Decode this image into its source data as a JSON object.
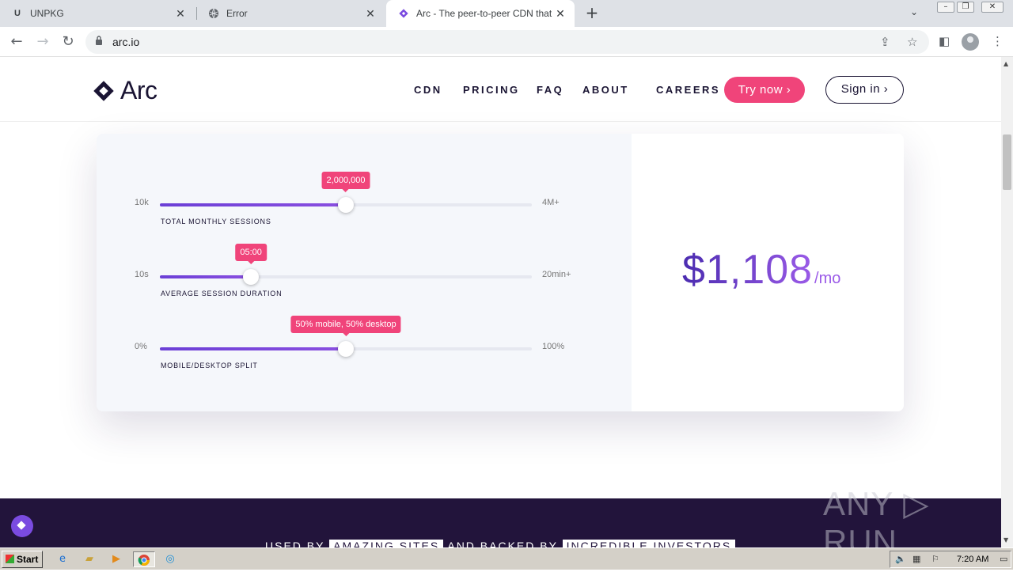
{
  "browser": {
    "tabs": [
      {
        "title": "UNPKG",
        "favicon": "U"
      },
      {
        "title": "Error",
        "favicon": "globe-icon"
      },
      {
        "title": "Arc - The peer-to-peer CDN that pa",
        "favicon": "arc-icon"
      }
    ],
    "url": "arc.io"
  },
  "site": {
    "logo": "Arc",
    "nav": [
      "CDN",
      "PRICING",
      "FAQ",
      "ABOUT",
      "CAREERS"
    ],
    "try_now": "Try now ›",
    "sign_in": "Sign in ›"
  },
  "calculator": {
    "sliders": [
      {
        "min": "10k",
        "max": "4M+",
        "value": "2,000,000",
        "label": "TOTAL MONTHLY SESSIONS",
        "fraction": 0.5
      },
      {
        "min": "10s",
        "max": "20min+",
        "value": "05:00",
        "label": "AVERAGE SESSION DURATION",
        "fraction": 0.245
      },
      {
        "min": "0%",
        "max": "100%",
        "value": "50% mobile, 50% desktop",
        "label": "MOBILE/DESKTOP SPLIT",
        "fraction": 0.5
      }
    ],
    "price": "$1,108",
    "price_unit": "/mo"
  },
  "footer_banner": {
    "t1": "USED BY",
    "h1": "AMAZING SITES",
    "t2": "AND BACKED BY",
    "h2": "INCREDIBLE INVESTORS"
  },
  "watermark": "ANY ▷ RUN",
  "taskbar": {
    "start": "Start",
    "clock": "7:20 AM"
  },
  "colors": {
    "accent_pink": "#f0447a",
    "brand_dark": "#1a1433",
    "slider_purple": "#6b3fd6"
  }
}
